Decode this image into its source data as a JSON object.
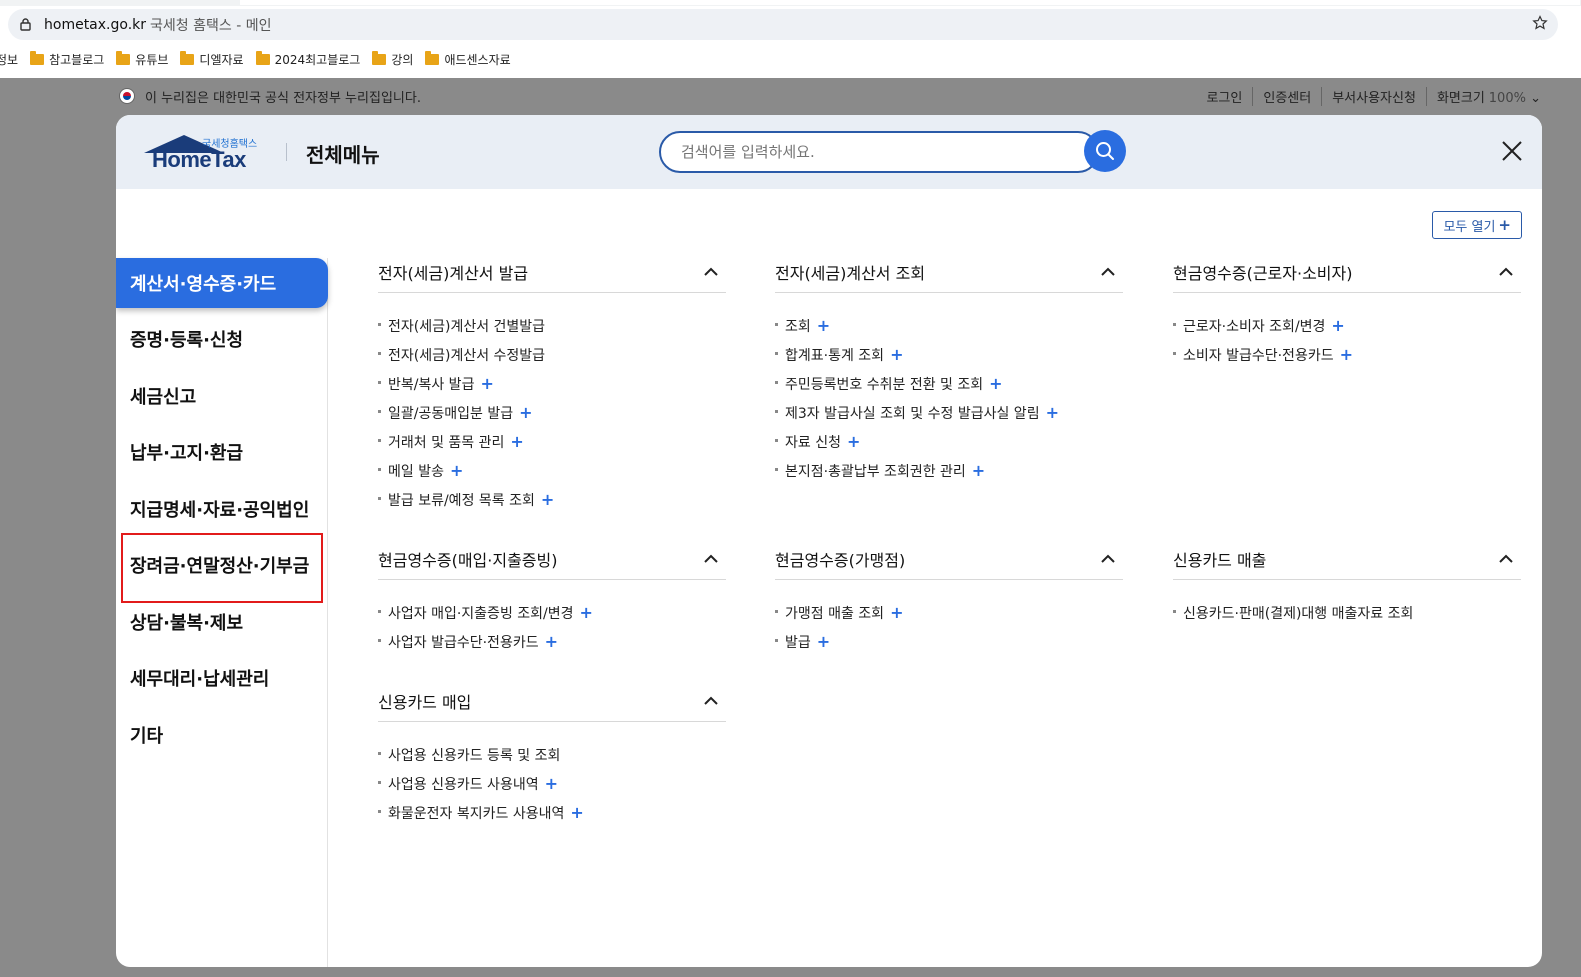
{
  "browser": {
    "url_domain": "hometax.go.kr",
    "tab_title": "국세청 홈택스 - 메인",
    "bookmarks_first": "정보",
    "bookmarks": [
      "참고블로그",
      "유튜브",
      "디엘자료",
      "2024최고블로그",
      "강의",
      "애드센스자료"
    ]
  },
  "gov_banner": {
    "text": "이 누리집은 대한민국 공식 전자정부 누리집입니다.",
    "links": [
      "로그인",
      "인증센터",
      "부서사용자신청",
      "화면크기"
    ],
    "zoom": "100%"
  },
  "modal": {
    "logo_small": "국세청홈택스",
    "logo_main": "HomeTax",
    "title": "전체메뉴",
    "search_placeholder": "검색어를 입력하세요.",
    "open_all": "모두 열기",
    "nav": [
      "계산서·영수증·카드",
      "증명·등록·신청",
      "세금신고",
      "납부·고지·환급",
      "지급명세·자료·공익법인",
      "장려금·연말정산·기부금",
      "상담·불복·제보",
      "세무대리·납세관리",
      "기타"
    ],
    "sections": [
      {
        "title": "전자(세금)계산서 발급",
        "items": [
          {
            "label": "전자(세금)계산서 건별발급",
            "plus": ""
          },
          {
            "label": "전자(세금)계산서 수정발급",
            "plus": ""
          },
          {
            "label": "반복/복사 발급",
            "plus": "+"
          },
          {
            "label": "일괄/공동매입분 발급",
            "plus": "+"
          },
          {
            "label": "거래처 및 품목 관리",
            "plus": "+"
          },
          {
            "label": "메일 발송",
            "plus": "+"
          },
          {
            "label": "발급 보류/예정 목록 조회",
            "plus": "+"
          }
        ]
      },
      {
        "title": "전자(세금)계산서 조회",
        "items": [
          {
            "label": "조회",
            "plus": "+"
          },
          {
            "label": "합계표·통계 조회",
            "plus": "+"
          },
          {
            "label": "주민등록번호 수취분 전환 및 조회",
            "plus": "+"
          },
          {
            "label": "제3자 발급사실 조회 및 수정 발급사실 알림",
            "plus": "+"
          },
          {
            "label": "자료 신청",
            "plus": "+"
          },
          {
            "label": "본지점·총괄납부 조회권한 관리",
            "plus": "+"
          }
        ]
      },
      {
        "title": "현금영수증(근로자·소비자)",
        "items": [
          {
            "label": "근로자·소비자 조회/변경",
            "plus": "+"
          },
          {
            "label": "소비자 발급수단·전용카드",
            "plus": "+"
          }
        ]
      },
      {
        "title": "현금영수증(매입·지출증빙)",
        "items": [
          {
            "label": "사업자 매입·지출증빙 조회/변경",
            "plus": "+"
          },
          {
            "label": "사업자 발급수단·전용카드",
            "plus": "+"
          }
        ]
      },
      {
        "title": "현금영수증(가맹점)",
        "items": [
          {
            "label": "가맹점 매출 조회",
            "plus": "+"
          },
          {
            "label": "발급",
            "plus": "+"
          }
        ]
      },
      {
        "title": "신용카드 매출",
        "items": [
          {
            "label": "신용카드·판매(결제)대행 매출자료 조회",
            "plus": ""
          }
        ]
      },
      {
        "title": "신용카드 매입",
        "items": [
          {
            "label": "사업용 신용카드 등록 및 조회",
            "plus": ""
          },
          {
            "label": "사업용 신용카드 사용내역",
            "plus": "+"
          },
          {
            "label": "화물운전자 복지카드 사용내역",
            "plus": "+"
          }
        ]
      }
    ]
  },
  "colors": {
    "accent": "#2a6de0",
    "highlight_box": "#e21b1b",
    "overlay": "#8a8a8a"
  }
}
